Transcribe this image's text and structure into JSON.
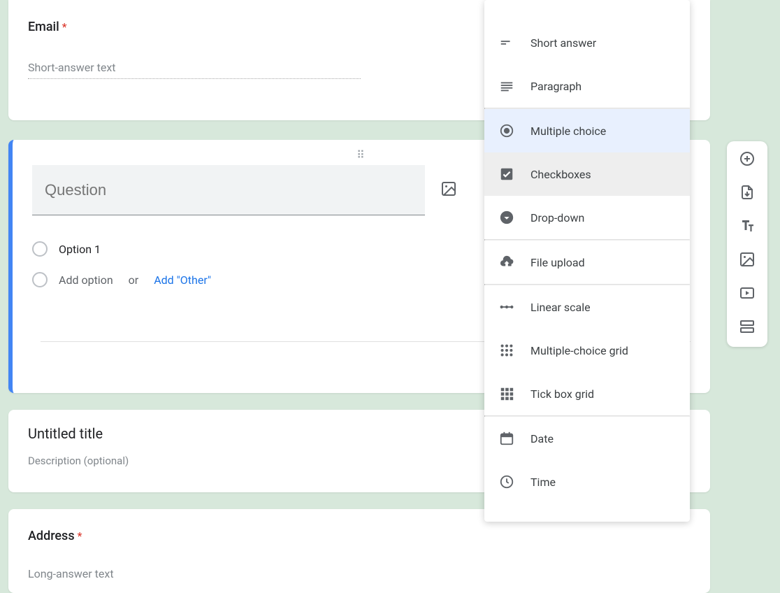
{
  "email_card": {
    "label": "Email",
    "placeholder": "Short-answer text"
  },
  "question_card": {
    "title_placeholder": "Question",
    "option1": "Option 1",
    "add_option": "Add option",
    "or": "or",
    "add_other": "Add \"Other\""
  },
  "section_card": {
    "title": "Untitled title",
    "description": "Description (optional)"
  },
  "address_card": {
    "label": "Address",
    "placeholder": "Long-answer text"
  },
  "type_menu": {
    "items": [
      {
        "label": "Short answer"
      },
      {
        "label": "Paragraph"
      },
      {
        "label": "Multiple choice"
      },
      {
        "label": "Checkboxes"
      },
      {
        "label": "Drop-down"
      },
      {
        "label": "File upload"
      },
      {
        "label": "Linear scale"
      },
      {
        "label": "Multiple-choice grid"
      },
      {
        "label": "Tick box grid"
      },
      {
        "label": "Date"
      },
      {
        "label": "Time"
      }
    ]
  }
}
